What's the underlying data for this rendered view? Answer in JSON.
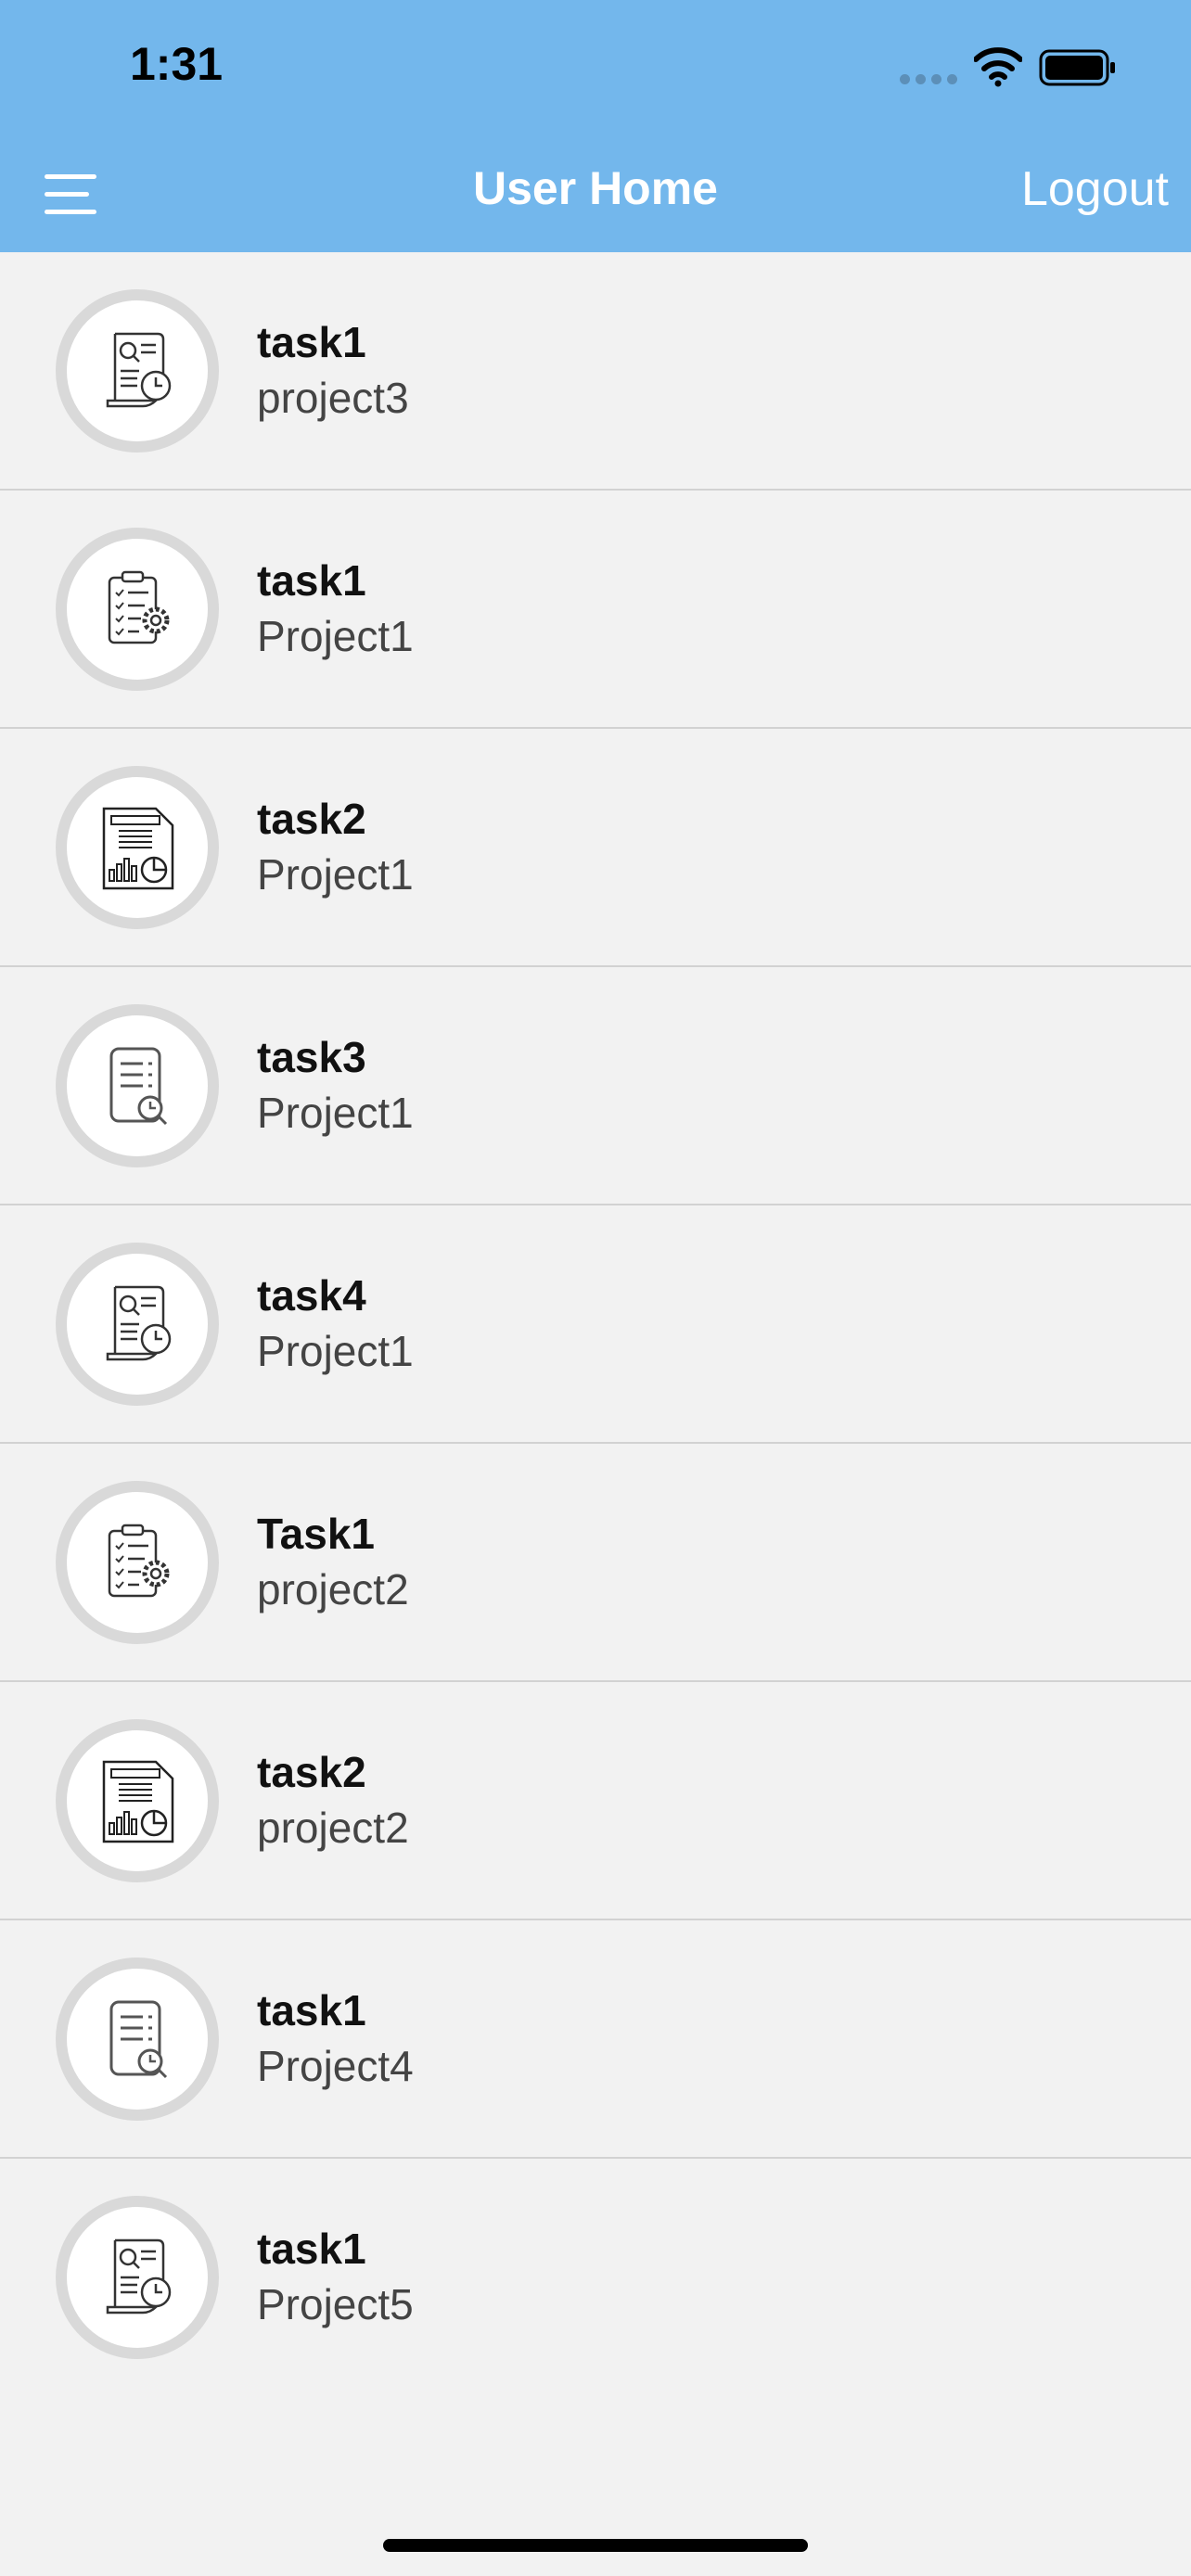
{
  "status_bar": {
    "time": "1:31"
  },
  "header": {
    "title": "User Home",
    "logout_label": "Logout"
  },
  "tasks": [
    {
      "name": "task1",
      "project": "project3",
      "icon": "report-search-clock-icon"
    },
    {
      "name": "task1",
      "project": "Project1",
      "icon": "clipboard-gear-icon"
    },
    {
      "name": "task2",
      "project": "Project1",
      "icon": "document-chart-icon"
    },
    {
      "name": "task3",
      "project": "Project1",
      "icon": "document-clock-icon"
    },
    {
      "name": "task4",
      "project": "Project1",
      "icon": "report-search-clock-icon"
    },
    {
      "name": "Task1",
      "project": "project2",
      "icon": "clipboard-gear-icon"
    },
    {
      "name": "task2",
      "project": "project2",
      "icon": "document-chart-icon"
    },
    {
      "name": "task1",
      "project": "Project4",
      "icon": "document-clock-icon"
    },
    {
      "name": "task1",
      "project": "Project5",
      "icon": "report-search-clock-icon"
    }
  ],
  "colors": {
    "header": "#73b7ec",
    "background": "#f2f2f2",
    "avatar_ring": "#d9d9d9",
    "divider": "#d2d2d2"
  }
}
